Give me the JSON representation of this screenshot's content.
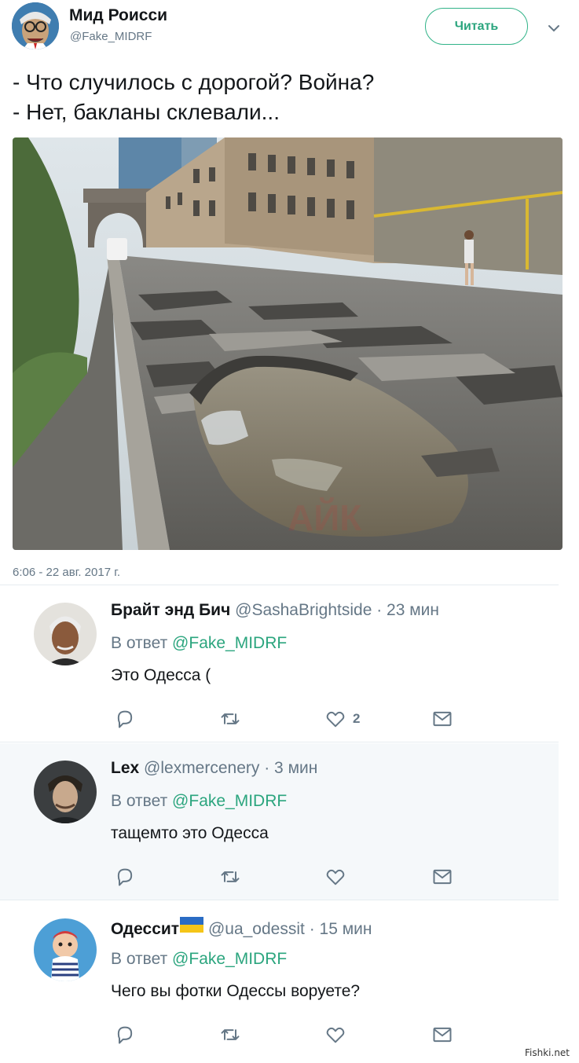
{
  "author": {
    "name": "Мид Роисси",
    "handle": "@Fake_MIDRF",
    "follow_label": "Читать"
  },
  "tweet": {
    "lines": [
      "- Что случилось с дорогой? Война?",
      "- Нет, бакланы склевали..."
    ],
    "timestamp": "6:06 - 22 авг. 2017 г."
  },
  "replies": [
    {
      "name": "Брайт энд Бич",
      "handle": "@SashaBrightside",
      "time": "· 23 мин",
      "reply_prefix": "В ответ",
      "mention": "@Fake_MIDRF",
      "text": "Это Одесса (",
      "likes": "2"
    },
    {
      "name": "Lex",
      "handle": "@lexmercenery",
      "time": "· 3 мин",
      "reply_prefix": "В ответ",
      "mention": "@Fake_MIDRF",
      "text": "тащемто это Одесса",
      "likes": ""
    },
    {
      "name": "Одессит",
      "handle": "@ua_odessit",
      "time": "· 15 мин",
      "reply_prefix": "В ответ",
      "mention": "@Fake_MIDRF",
      "text": "Чего вы фотки Одессы воруете?",
      "likes": ""
    }
  ],
  "icons": {
    "reply": "reply-icon",
    "retweet": "retweet-icon",
    "like": "heart-icon",
    "message": "envelope-icon",
    "menu": "chevron-down-icon"
  },
  "colors": {
    "accent": "#2ba57e",
    "muted": "#657786",
    "text": "#14171a"
  },
  "watermark": "Fishki.net"
}
